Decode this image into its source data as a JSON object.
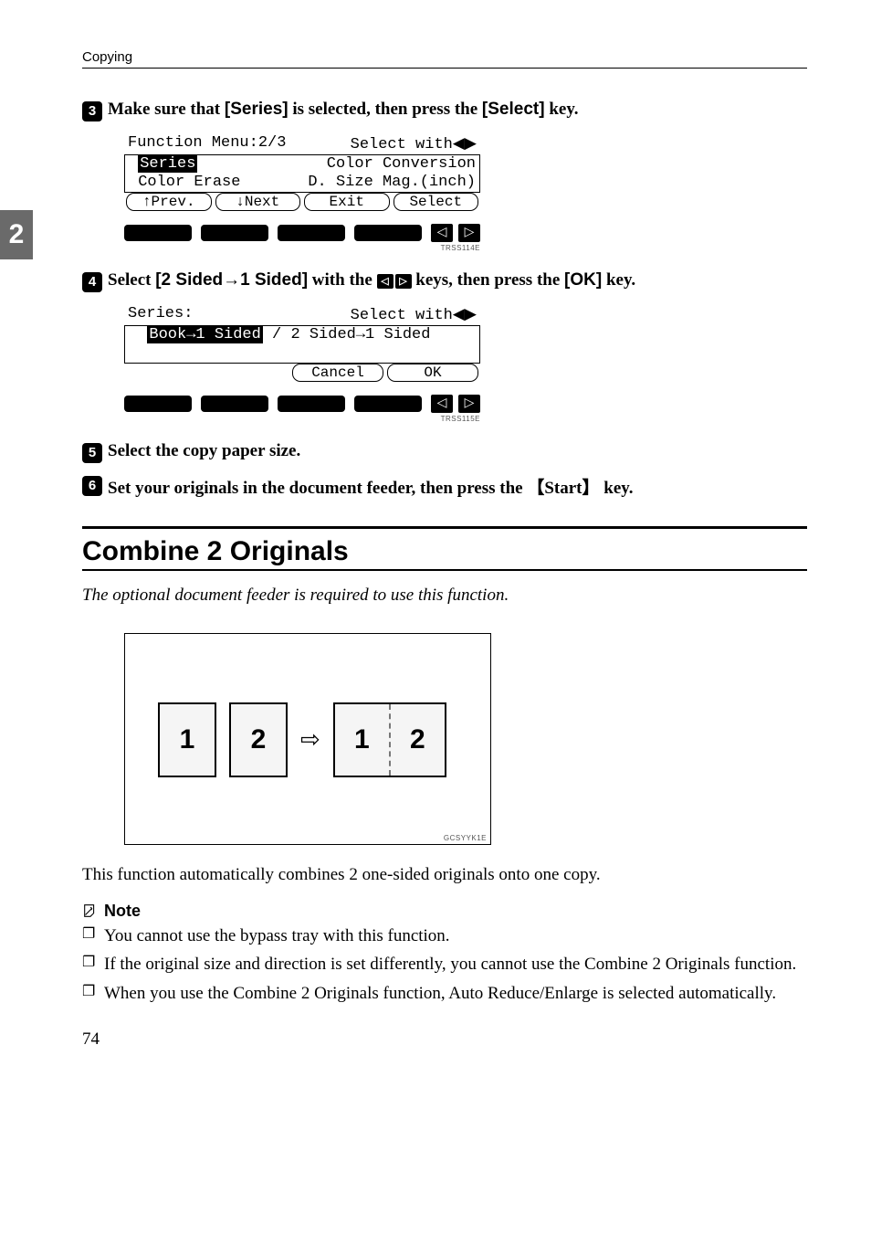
{
  "running_head": "Copying",
  "side_tab": "2",
  "step3": {
    "num": "3",
    "pre": "Make sure that ",
    "key1": "[Series]",
    "mid": " is selected, then press the ",
    "key2": "[Select]",
    "post": " key."
  },
  "lcd1": {
    "title_left": "Function Menu:2/3",
    "title_right": "Select with",
    "row1_left": "Series",
    "row1_right": "Color Conversion",
    "row2_left": " Color Erase",
    "row2_right": "D. Size Mag.(inch)",
    "b1": "↑Prev.",
    "b2": "↓Next",
    "b3": "Exit",
    "b4": "Select",
    "fig_id": "TRSS114E"
  },
  "step4": {
    "num": "4",
    "pre": "Select ",
    "key1": "[2 Sided→1 Sided]",
    "mid": " with the ",
    "post": " keys, then press the ",
    "key2": "[OK]",
    "post2": " key."
  },
  "lcd2": {
    "title_left": "Series:",
    "title_right": "Select with",
    "row1_left": "Book→1 Sided",
    "row1_mid": " / ",
    "row1_right": "2 Sided→1 Sided",
    "b1": "Cancel",
    "b2": "OK",
    "fig_id": "TRSS115E"
  },
  "step5": {
    "num": "5",
    "text": "Select the copy paper size."
  },
  "step6": {
    "num": "6",
    "pre": "Set your originals in the document feeder, then press the ",
    "key": "Start",
    "post": " key."
  },
  "section_title": "Combine 2 Originals",
  "intro": "The optional document feeder is required to use this function.",
  "combine": {
    "a": "1",
    "b": "2",
    "c": "1",
    "d": "2",
    "fig_id": "GCSYYK1E"
  },
  "desc": "This function automatically combines 2 one-sided originals onto one copy.",
  "note_label": "Note",
  "notes": {
    "n1": "You cannot use the bypass tray with this function.",
    "n2": "If the original size and direction is set differently, you cannot use the Combine 2 Originals function.",
    "n3": "When you use the Combine 2 Originals function, Auto Reduce/Enlarge is selected automatically."
  },
  "page_num": "74"
}
